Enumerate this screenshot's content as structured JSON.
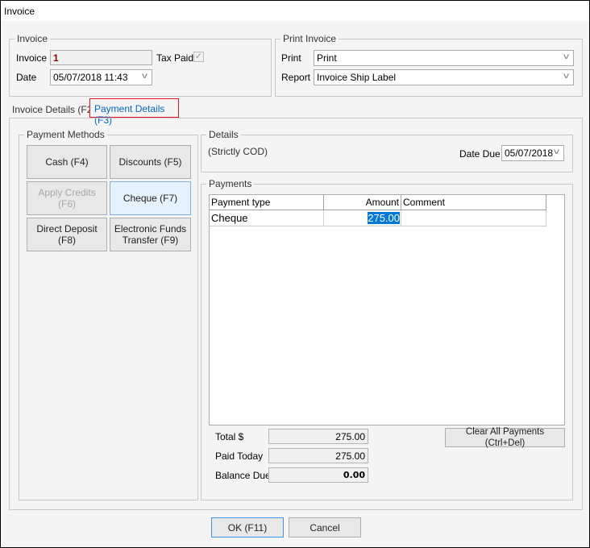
{
  "window": {
    "title": "Invoice"
  },
  "invoice_group": {
    "label": "Invoice",
    "invoice_label": "Invoice",
    "invoice_value": "1",
    "tax_paid_label": "Tax Paid",
    "tax_paid_checked": true,
    "date_label": "Date",
    "date_value": "05/07/2018 11:43"
  },
  "print_group": {
    "label": "Print Invoice",
    "print_label": "Print",
    "print_value": "Print",
    "report_label": "Report",
    "report_value": "Invoice Ship Label"
  },
  "tabs": [
    {
      "label": "Invoice Details (F2)",
      "active": false
    },
    {
      "label": "Payment Details (F3)",
      "active": true
    }
  ],
  "payment_methods": {
    "label": "Payment Methods",
    "buttons": [
      {
        "label": "Cash (F4)",
        "state": "normal"
      },
      {
        "label": "Discounts (F5)",
        "state": "normal"
      },
      {
        "label": "Apply Credits (F6)",
        "state": "disabled"
      },
      {
        "label": "Cheque (F7)",
        "state": "selected"
      },
      {
        "label": "Direct Deposit (F8)",
        "state": "normal"
      },
      {
        "label": "Electronic Funds Transfer (F9)",
        "state": "normal"
      }
    ]
  },
  "details": {
    "label": "Details",
    "terms": "(Strictly COD)",
    "date_due_label": "Date Due",
    "date_due_value": "05/07/2018"
  },
  "payments": {
    "label": "Payments",
    "columns": [
      "Payment type",
      "Amount",
      "Comment"
    ],
    "rows": [
      {
        "type": "Cheque",
        "amount": "275.00",
        "comment": ""
      }
    ],
    "total_label": "Total $",
    "total_value": "275.00",
    "paid_label": "Paid Today",
    "paid_value": "275.00",
    "balance_label": "Balance Due",
    "balance_value": "0.00",
    "clear_label": "Clear All Payments (Ctrl+Del)"
  },
  "footer": {
    "ok_label": "OK (F11)",
    "cancel_label": "Cancel"
  },
  "colors": {
    "accent": "#0066cc",
    "selection": "#0078d7",
    "tab_highlight": "#e81123",
    "invoice_number": "#8b0000"
  }
}
